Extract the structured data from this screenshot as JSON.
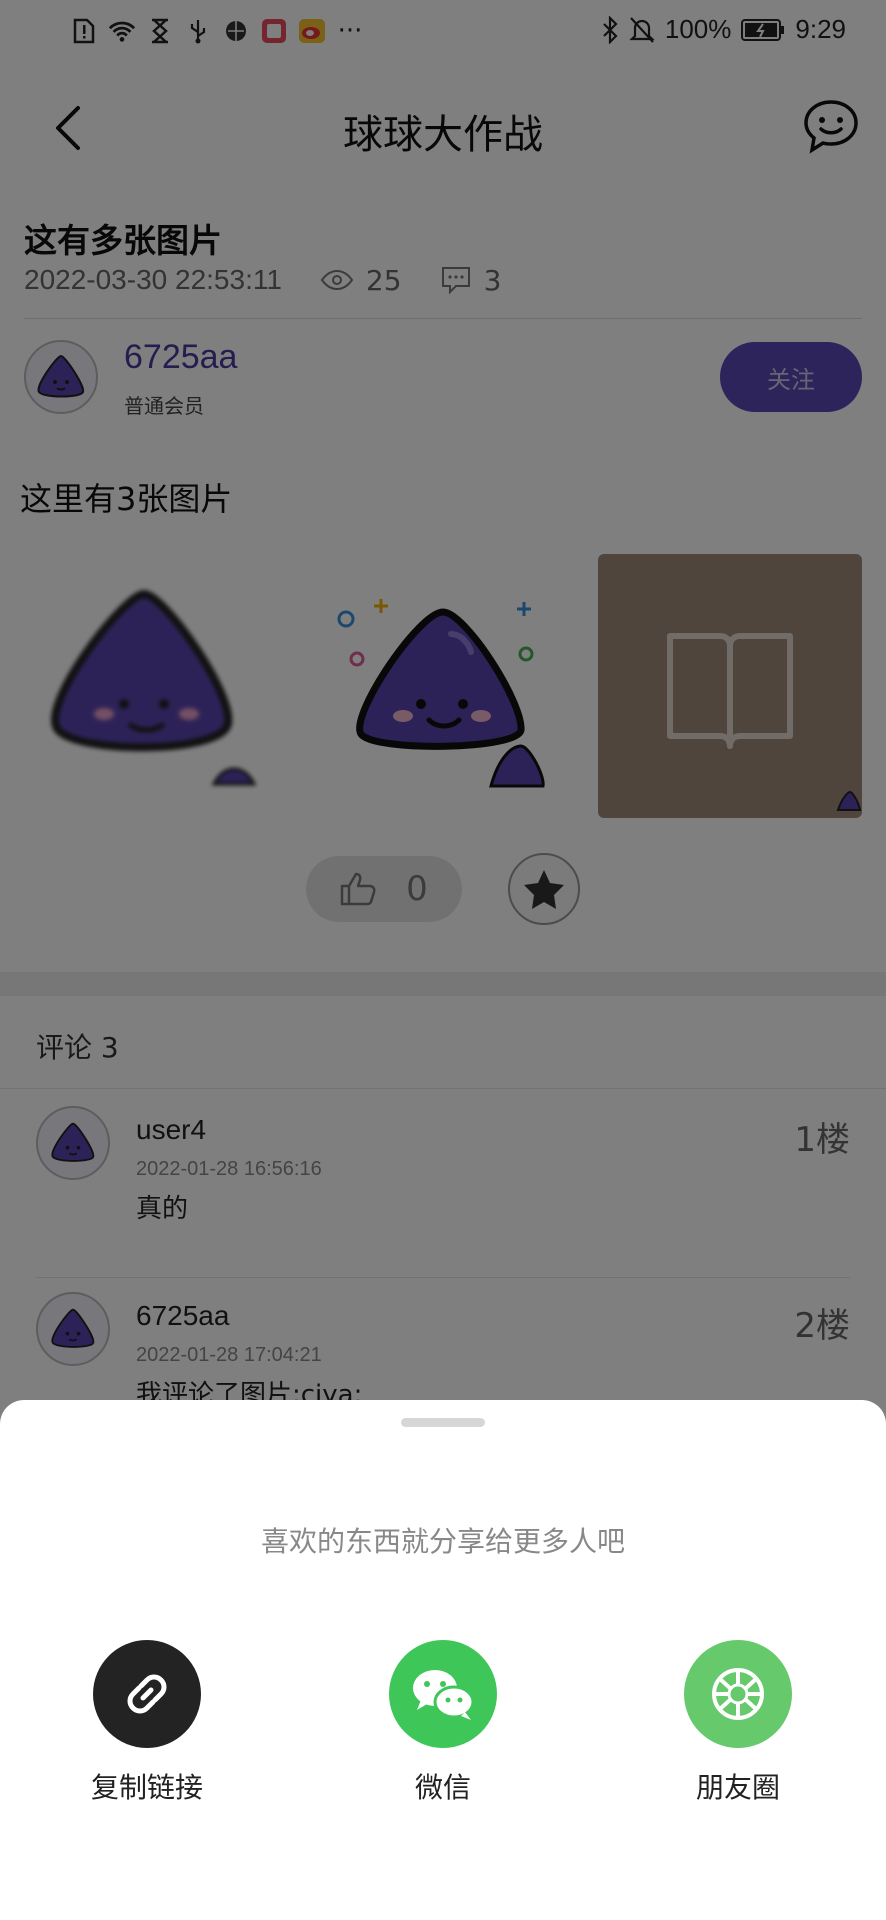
{
  "status_bar": {
    "battery": "100%",
    "time": "9:29",
    "more": "···"
  },
  "header": {
    "title": "球球大作战"
  },
  "post": {
    "title": "这有多张图片",
    "date": "2022-03-30 22:53:11",
    "views": "25",
    "comments": "3",
    "body": "这里有3张图片"
  },
  "author": {
    "name": "6725aa",
    "role": "普通会员",
    "follow_label": "关注"
  },
  "actions": {
    "likes": "0"
  },
  "comments_section": {
    "title": "评论 3",
    "items": [
      {
        "user": "user4",
        "time": "2022-01-28 16:56:16",
        "text": "真的",
        "floor": "1楼"
      },
      {
        "user": "6725aa",
        "time": "2022-01-28 17:04:21",
        "text": "我评论了图片:ciya:",
        "floor": "2楼"
      }
    ]
  },
  "share_sheet": {
    "title": "喜欢的东西就分享给更多人吧",
    "options": [
      {
        "label": "复制链接",
        "icon": "link-icon",
        "color": "#232323"
      },
      {
        "label": "微信",
        "icon": "wechat-icon",
        "color": "#3fc659"
      },
      {
        "label": "朋友圈",
        "icon": "moments-icon",
        "color": "#66c96c"
      }
    ]
  },
  "colors": {
    "accent": "#5a48b8",
    "mascot": "#5b45b0",
    "overlay": "rgba(0,0,0,0.5)"
  }
}
